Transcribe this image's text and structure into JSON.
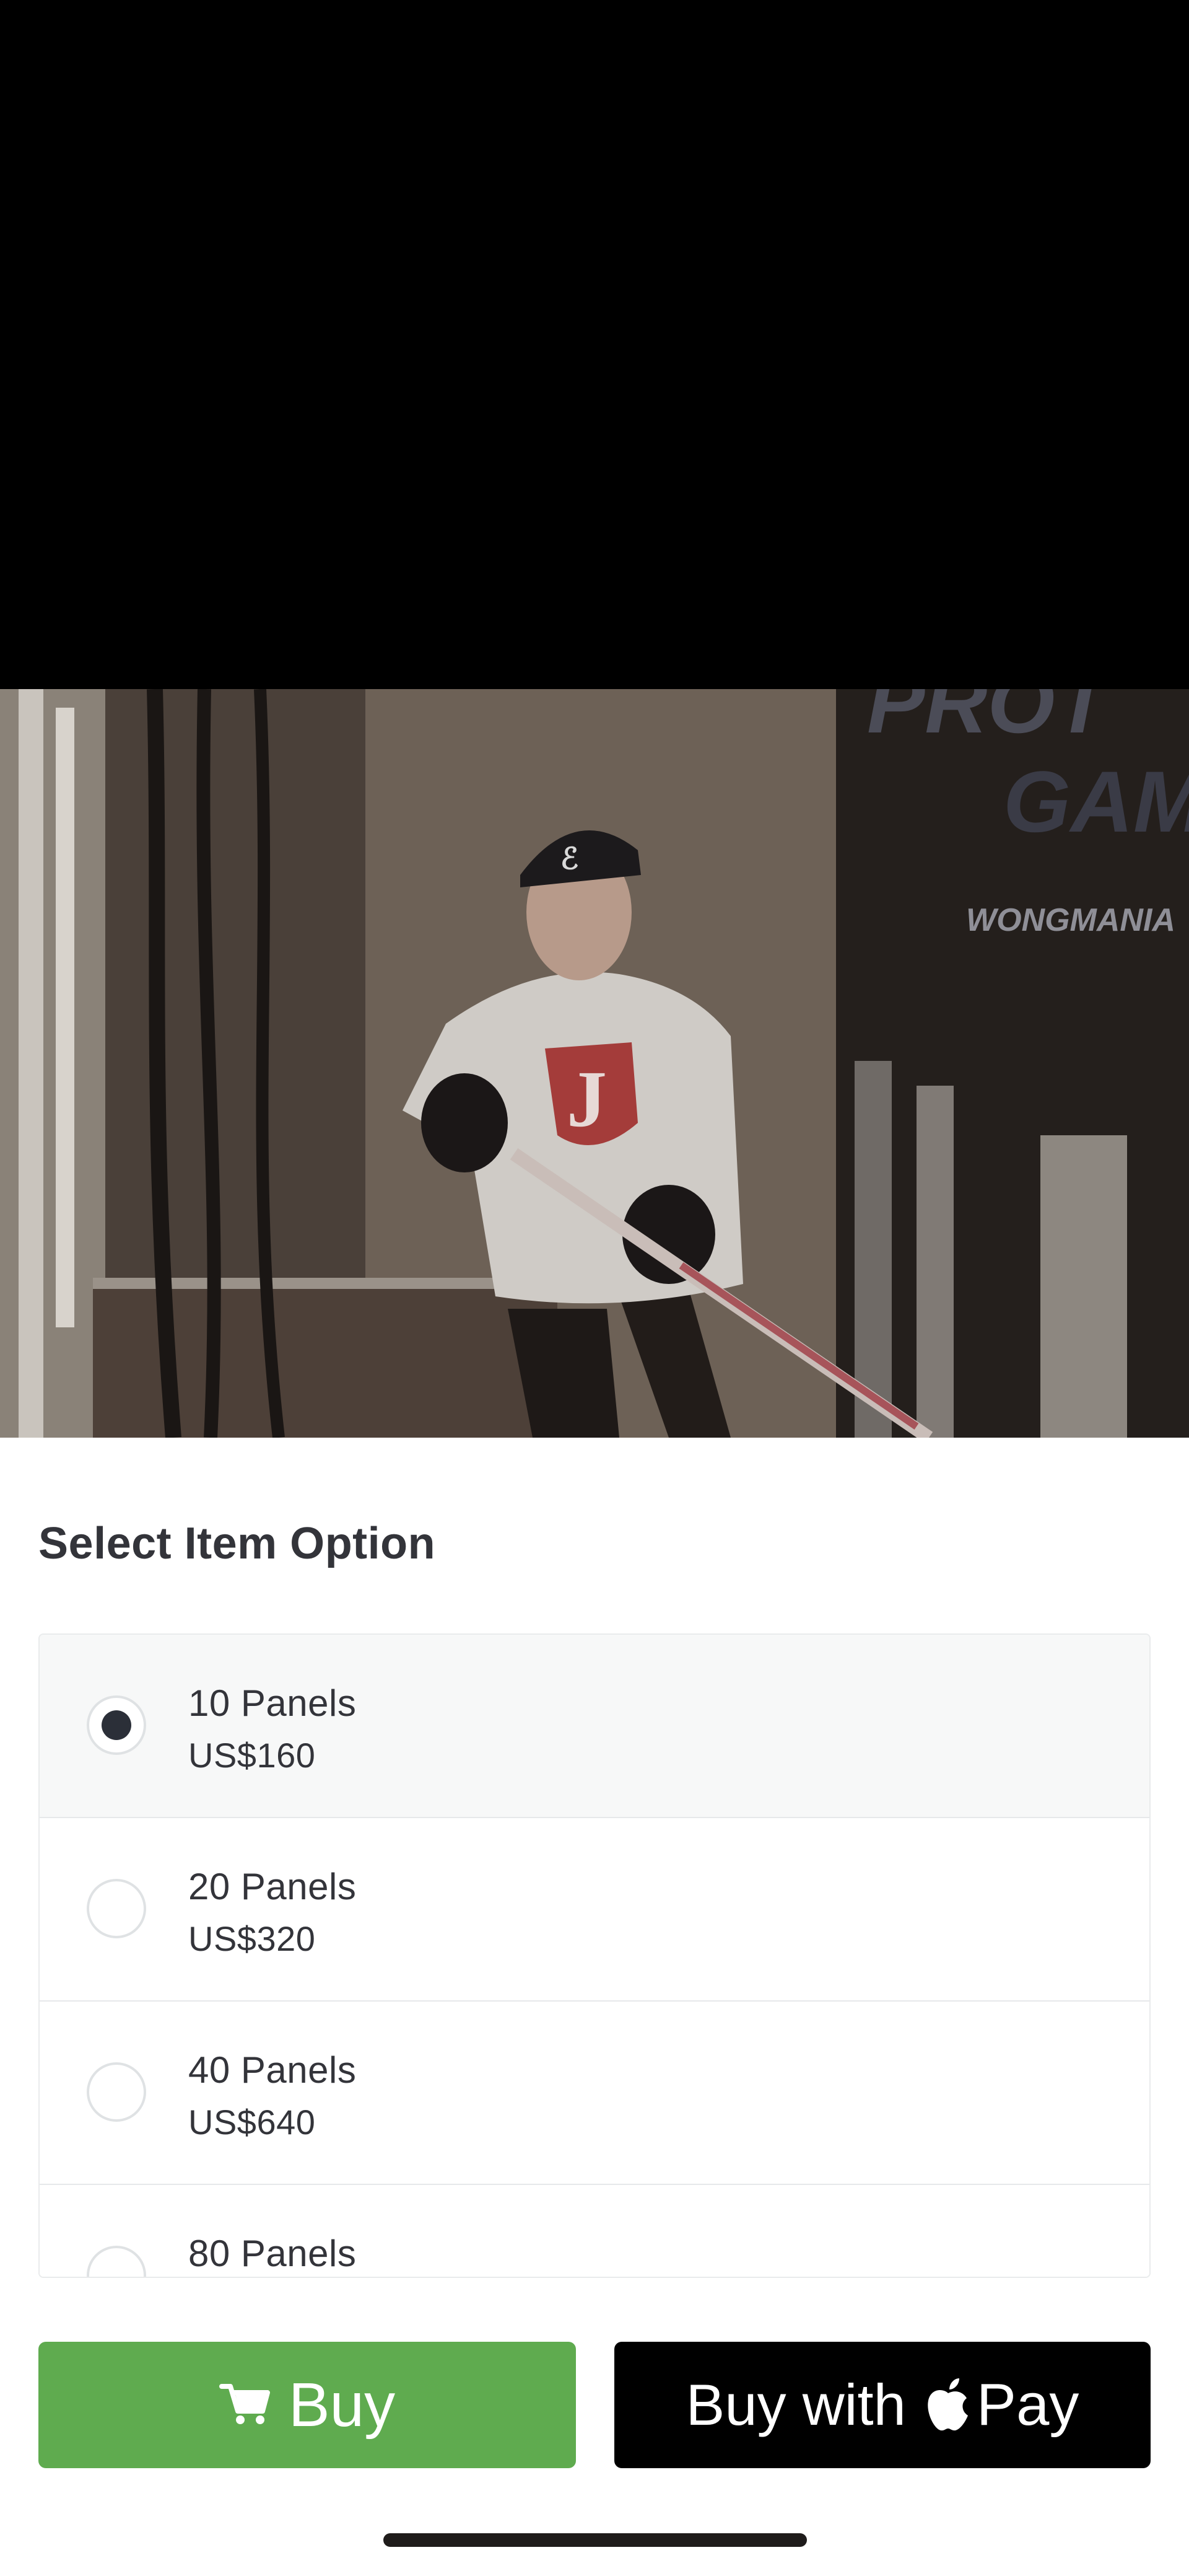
{
  "product_image": {
    "alt_icon": "product-photo"
  },
  "options_title": "Select Item Option",
  "options": [
    {
      "name": "10 Panels",
      "price": "US$160",
      "selected": true
    },
    {
      "name": "20 Panels",
      "price": "US$320",
      "selected": false
    },
    {
      "name": "40 Panels",
      "price": "US$640",
      "selected": false
    },
    {
      "name": "80 Panels",
      "price": "",
      "selected": false
    }
  ],
  "buttons": {
    "buy_label": "Buy",
    "buy_icon": "cart-icon",
    "buy_color": "#5fab4f",
    "applepay_label_prefix": "Buy with",
    "applepay_label_suffix": "Pay",
    "applepay_icon": "apple-icon"
  }
}
